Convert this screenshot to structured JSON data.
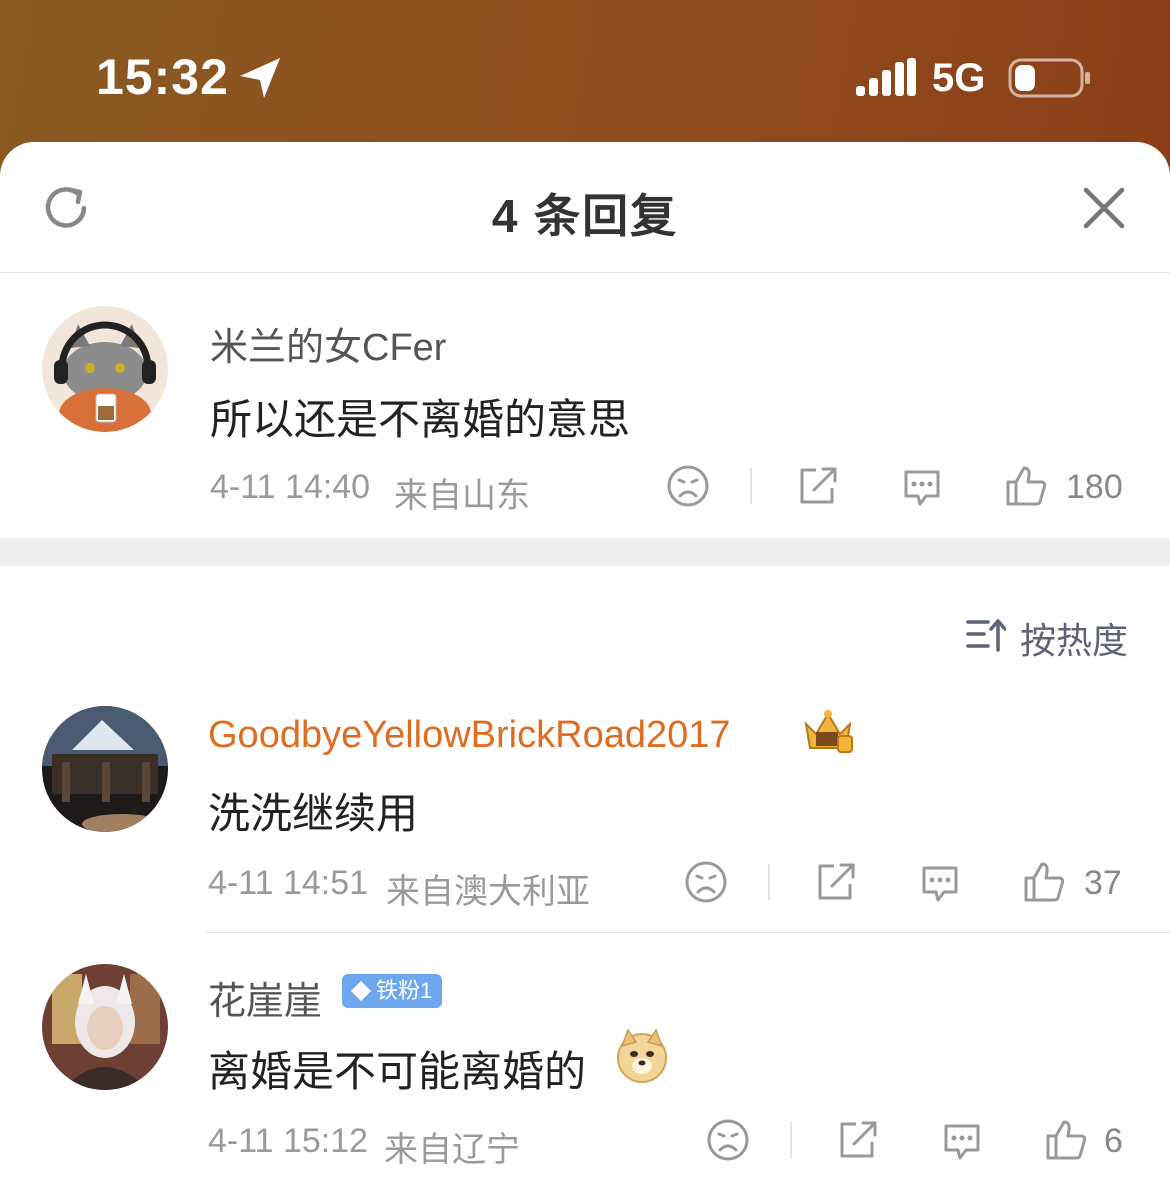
{
  "status_bar": {
    "time": "15:32",
    "network": "5G",
    "icons": [
      "location-arrow-icon",
      "signal-icon",
      "battery-icon"
    ]
  },
  "header": {
    "title": "4 条回复",
    "left_icon": "refresh-icon",
    "right_icon": "close-icon"
  },
  "parent_comment": {
    "username": "米兰的女CFer",
    "text": "所以还是不离婚的意思",
    "time": "4-11 14:40",
    "location": "来自山东",
    "likes": "180"
  },
  "sort_label": "按热度",
  "replies": [
    {
      "username": "GoodbyeYellowBrickRoad2017",
      "badge": "crown-badge",
      "text": "洗洗继续用",
      "time": "4-11 14:51",
      "location": "来自澳大利亚",
      "likes": "37"
    },
    {
      "username": "花崖崖",
      "badge_label": "铁粉1",
      "text": "离婚是不可能离婚的",
      "emoji": "doge-emoji",
      "time": "4-11 15:12",
      "location": "来自辽宁",
      "likes": "6"
    }
  ],
  "colors": {
    "vip_name": "#e06c1f",
    "normal_name": "#555555",
    "accent_bar": "#8f4a1d"
  }
}
